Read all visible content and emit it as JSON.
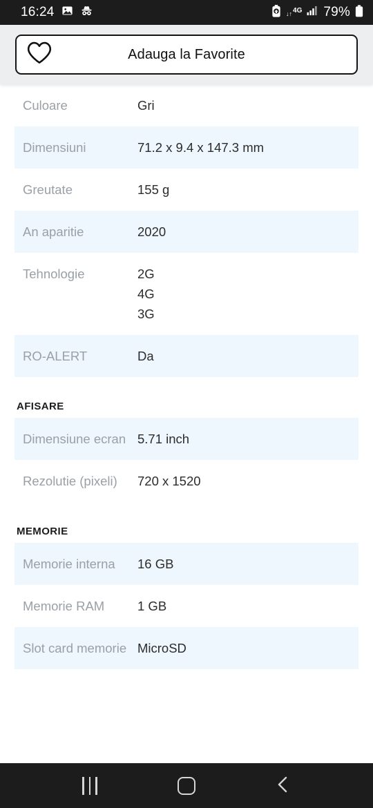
{
  "status_bar": {
    "time": "16:24",
    "left_icons": [
      "image-icon",
      "incognito-icon"
    ],
    "battery_saver_icon": "battery-saver-icon",
    "network_type": "4G",
    "network_arrows": "↓↑",
    "signal_icon": "signal-bars-icon",
    "battery_percent": "79%",
    "battery_icon": "battery-icon"
  },
  "header": {
    "favorite_label": "Adauga la Favorite",
    "heart_icon": "heart-outline-icon"
  },
  "sections": [
    {
      "title": null,
      "rows": [
        {
          "label": "Culoare",
          "value": "Gri"
        },
        {
          "label": "Dimensiuni",
          "value": "71.2 x 9.4 x 147.3 mm"
        },
        {
          "label": "Greutate",
          "value": "155 g"
        },
        {
          "label": "An aparitie",
          "value": "2020"
        },
        {
          "label": "Tehnologie",
          "value": "2G\n4G\n3G"
        },
        {
          "label": "RO-ALERT",
          "value": "Da"
        }
      ]
    },
    {
      "title": "AFISARE",
      "rows": [
        {
          "label": "Dimensiune ecran",
          "value": "5.71 inch"
        },
        {
          "label": "Rezolutie (pixeli)",
          "value": "720 x 1520"
        }
      ]
    },
    {
      "title": "MEMORIE",
      "rows": [
        {
          "label": "Memorie interna",
          "value": "16 GB"
        },
        {
          "label": "Memorie RAM",
          "value": "1 GB"
        },
        {
          "label": "Slot card memorie",
          "value": "MicroSD"
        }
      ]
    }
  ],
  "nav_bar": {
    "recents_label": "recents-icon",
    "home_label": "home-icon",
    "back_label": "back-icon"
  },
  "colors": {
    "alt_row": "#eef7fd",
    "label_text": "#9aa0a6",
    "value_text": "#2c2c2c",
    "header_bg": "#eceef0",
    "system_bar": "#1c1c1c"
  }
}
